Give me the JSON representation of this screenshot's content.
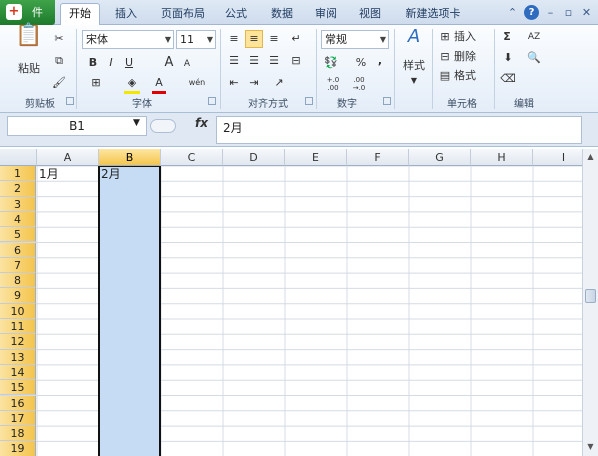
{
  "tabs": {
    "file": "件",
    "items": [
      "开始",
      "插入",
      "页面布局",
      "公式",
      "数据",
      "审阅",
      "视图",
      "新建选项卡"
    ]
  },
  "ribbon": {
    "clipboard": {
      "paste": "粘贴",
      "label": "剪贴板"
    },
    "font": {
      "name": "宋体",
      "size": "11",
      "bold": "B",
      "italic": "I",
      "underline": "U",
      "grow": "A",
      "shrink": "A",
      "color": "A",
      "label": "字体"
    },
    "alignment": {
      "label": "对齐方式"
    },
    "number": {
      "format": "常规",
      "percent": "%",
      "comma": ",",
      "label": "数字",
      "inc": "+.0 .00",
      "dec": ".00 →.0"
    },
    "styles": {
      "label": "样式"
    },
    "cells": {
      "insert": "插入",
      "delete": "删除",
      "format": "格式",
      "label": "单元格"
    },
    "editing": {
      "sum": "Σ",
      "sort": "AZ",
      "label": "编辑"
    }
  },
  "formula_bar": {
    "name_box": "B1",
    "fx": "fx",
    "value": "2月"
  },
  "grid": {
    "columns": [
      "A",
      "B",
      "C",
      "D",
      "E",
      "F",
      "G",
      "H",
      "I"
    ],
    "selected_column": "B",
    "rows": [
      "1",
      "2",
      "3",
      "4",
      "5",
      "6",
      "7",
      "8",
      "9",
      "10",
      "11",
      "12",
      "13",
      "14",
      "15",
      "16",
      "17",
      "18",
      "19"
    ],
    "cells": {
      "A1": "1月",
      "B1": "2月"
    }
  }
}
